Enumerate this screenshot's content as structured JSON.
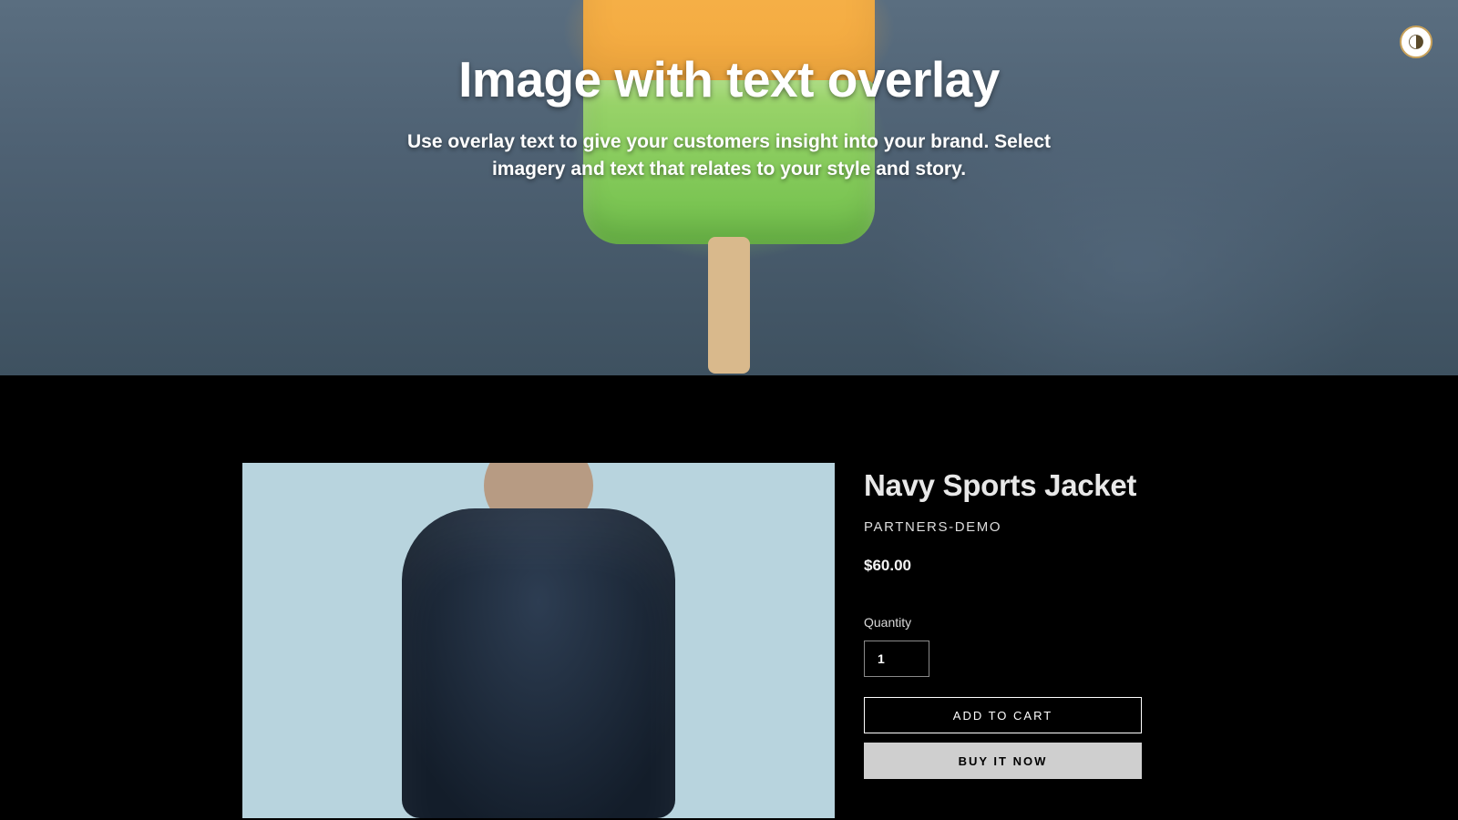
{
  "hero": {
    "title": "Image with text overlay",
    "subtitle": "Use overlay text to give your customers insight into your brand. Select imagery and text that relates to your style and story."
  },
  "theme_toggle": {
    "icon": "half-moon-icon"
  },
  "product": {
    "title": "Navy Sports Jacket",
    "vendor": "PARTNERS-DEMO",
    "price": "$60.00",
    "quantity_label": "Quantity",
    "quantity_value": "1",
    "add_to_cart_label": "ADD TO CART",
    "buy_now_label": "BUY IT NOW"
  },
  "colors": {
    "page_bg": "#000000",
    "text_light": "#e8e8e8",
    "button_solid_bg": "#cfcfcf"
  }
}
